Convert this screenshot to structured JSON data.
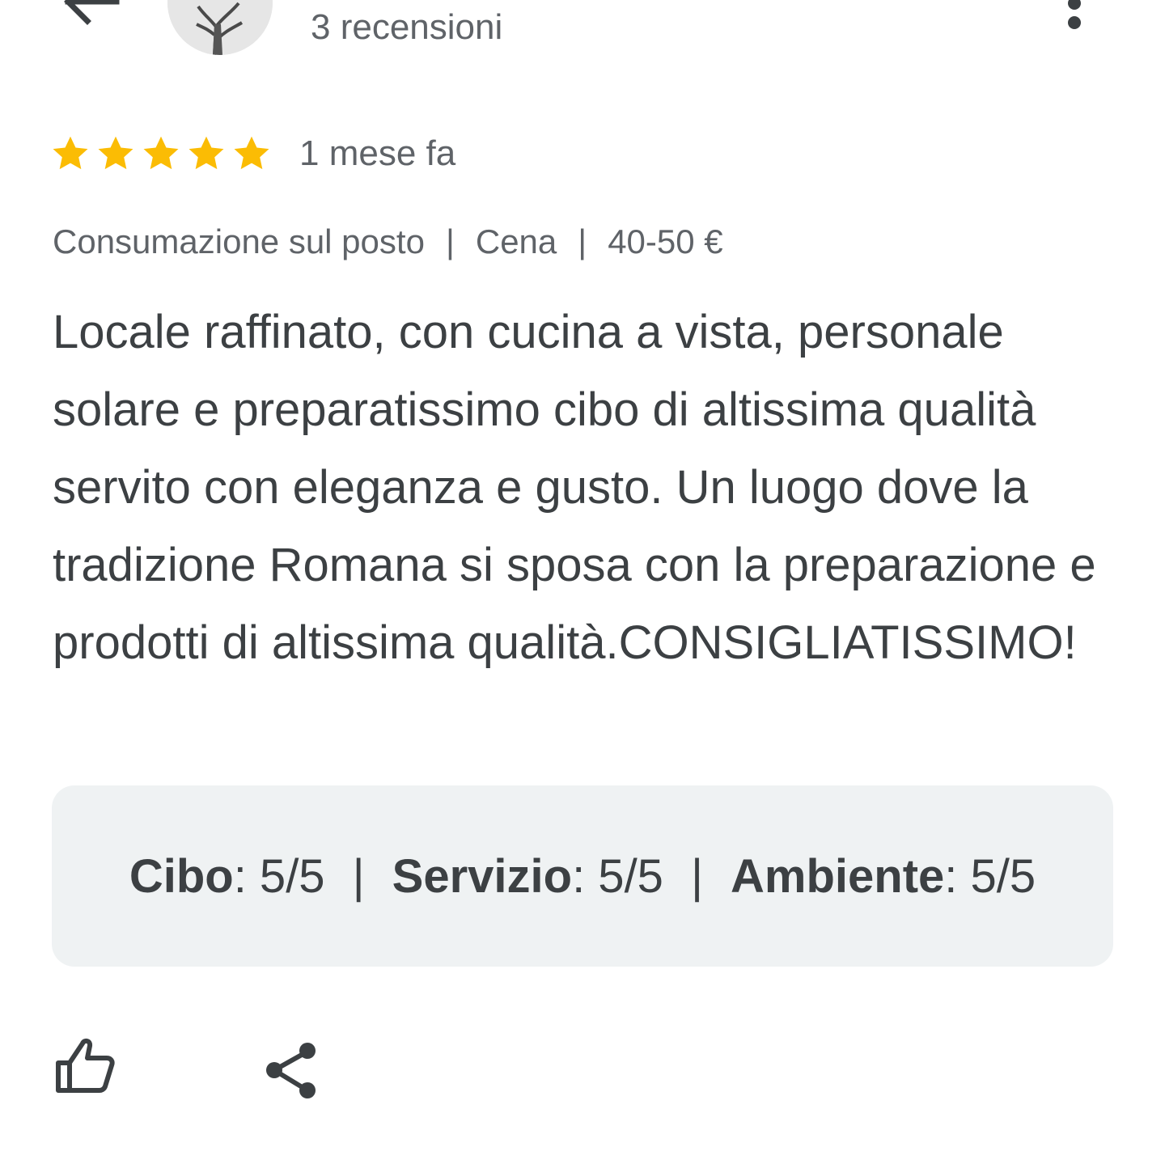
{
  "header": {
    "reviews_count": "3 recensioni",
    "back_icon": "arrow-back-icon",
    "more_icon": "more-vert-icon"
  },
  "review": {
    "rating": 5,
    "max_rating": 5,
    "star_color": "#fbbc04",
    "date": "1 mese fa",
    "meta": {
      "service": "Consumazione sul posto",
      "meal": "Cena",
      "price": "40-50 €",
      "separator": "|"
    },
    "text": "Locale raffinato, con cucina a vista, personale solare e preparatissimo cibo di altissima qualità servito con eleganza e gusto. Un luogo dove la tradizione Romana si sposa con la preparazione e prodotti di altissima qualità.CONSIGLIATISSIMO!",
    "scores": {
      "food_label": "Cibo",
      "food_value": ": 5/5",
      "service_label": "Servizio",
      "service_value": ": 5/5",
      "ambience_label": "Ambiente",
      "ambience_value": ": 5/5",
      "separator": "|"
    }
  },
  "actions": {
    "like_icon": "thumb-up-icon",
    "share_icon": "share-icon"
  },
  "colors": {
    "text_primary": "#3c4043",
    "text_secondary": "#5f6368",
    "scores_background": "#eff2f3"
  }
}
